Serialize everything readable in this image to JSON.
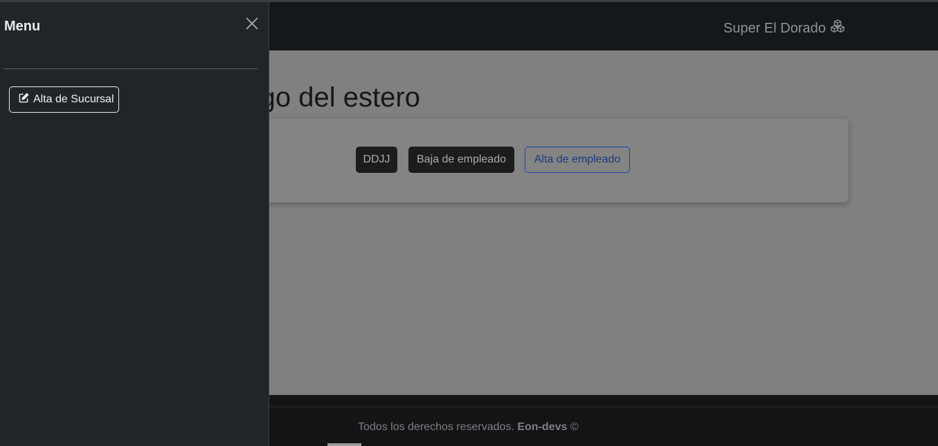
{
  "navbar": {
    "brand_text": "Super El Dorado",
    "brand_icon": "boxes-icon"
  },
  "main": {
    "heading": "Sindicato sgo del estero",
    "buttons": {
      "ddjj": "DDJJ",
      "baja_empleado": "Baja de empleado",
      "alta_empleado": "Alta de empleado"
    }
  },
  "footer": {
    "text": "Todos los derechos reservados.",
    "brand": "Eon-devs",
    "copyright": "©"
  },
  "offcanvas": {
    "title": "Menu",
    "close_icon": "close-icon",
    "items": [
      {
        "label": "Alta de Sucursal",
        "icon": "edit-icon"
      }
    ]
  },
  "colors": {
    "navbar_bg": "#15181b",
    "offcanvas_bg": "#212529",
    "backdrop": "#808080",
    "outline_primary": "#1d45a8"
  }
}
